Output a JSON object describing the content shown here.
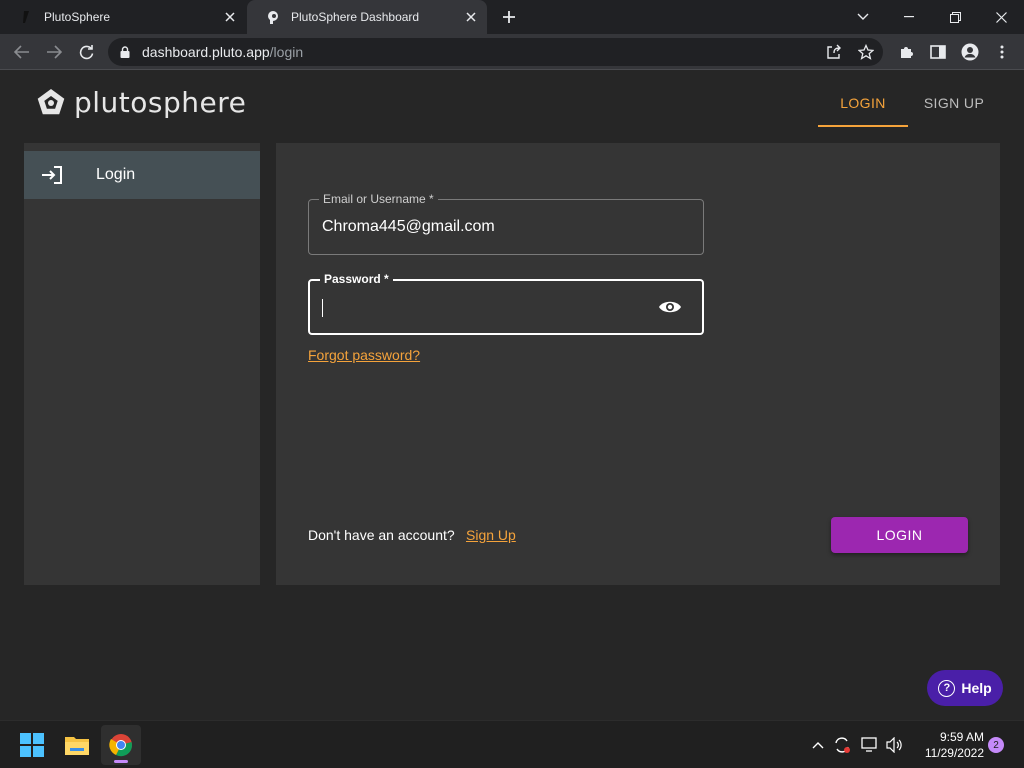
{
  "browser": {
    "tabs": [
      {
        "title": "PlutoSphere"
      },
      {
        "title": "PlutoSphere Dashboard"
      }
    ],
    "url_host": "dashboard.pluto.app",
    "url_path": "/login"
  },
  "header": {
    "logo_text": "plutosphere",
    "nav_login": "LOGIN",
    "nav_signup": "SIGN UP"
  },
  "sidebar": {
    "items": [
      {
        "label": "Login",
        "icon": "login-icon"
      }
    ]
  },
  "form": {
    "email_label": "Email or Username *",
    "email_value": "Chroma445@gmail.com",
    "password_label": "Password *",
    "password_value": "",
    "forgot_label": "Forgot password?",
    "no_account_text": "Don't have an account?",
    "signup_link": "Sign Up",
    "login_button": "LOGIN"
  },
  "help_button": "Help",
  "taskbar": {
    "time": "9:59 AM",
    "date": "11/29/2022",
    "notifications": "2"
  },
  "colors": {
    "accent": "#f5a33b",
    "login_button": "#9c27b0",
    "help_button": "#4a1fa8",
    "sidebar_active": "#455055"
  }
}
